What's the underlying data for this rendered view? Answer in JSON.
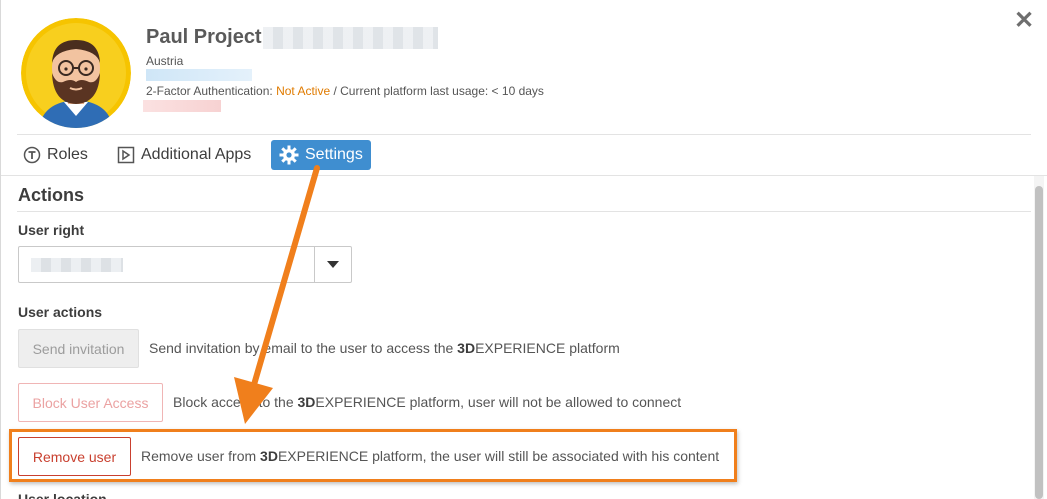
{
  "dialog": {
    "close_label": "✕"
  },
  "user": {
    "name": "Paul Project",
    "country": "Austria",
    "tfa_label": "2-Factor Authentication:",
    "tfa_status": "Not Active",
    "usage_label": "/ Current platform last usage:",
    "usage_value": "< 10 days"
  },
  "tabs": [
    {
      "label": "Roles",
      "icon": "roles-icon"
    },
    {
      "label": "Additional Apps",
      "icon": "apps-icon"
    },
    {
      "label": "Settings",
      "icon": "gear-icon",
      "active": true
    }
  ],
  "actions": {
    "title": "Actions",
    "user_right_label": "User right",
    "user_actions_label": "User actions",
    "invite": {
      "button": "Send invitation",
      "desc_pre": "Send invitation by email to the user to access the",
      "brand_bold": "3D",
      "brand_rest": "EXPERIENCE",
      "desc_post": "platform"
    },
    "block": {
      "button": "Block User Access",
      "desc_pre": "Block access to the",
      "brand_bold": "3D",
      "brand_rest": "EXPERIENCE",
      "desc_post": "platform, user will not be allowed to connect"
    },
    "remove": {
      "button": "Remove user",
      "desc_pre": "Remove user from",
      "brand_bold": "3D",
      "brand_rest": "EXPERIENCE",
      "desc_post": "platform, the user will still be associated with his content"
    },
    "location_label": "User location"
  },
  "colors": {
    "accent": "#3f8ed0",
    "warning": "#e07b00",
    "danger": "#c9402f",
    "annotation": "#f07f1c"
  }
}
